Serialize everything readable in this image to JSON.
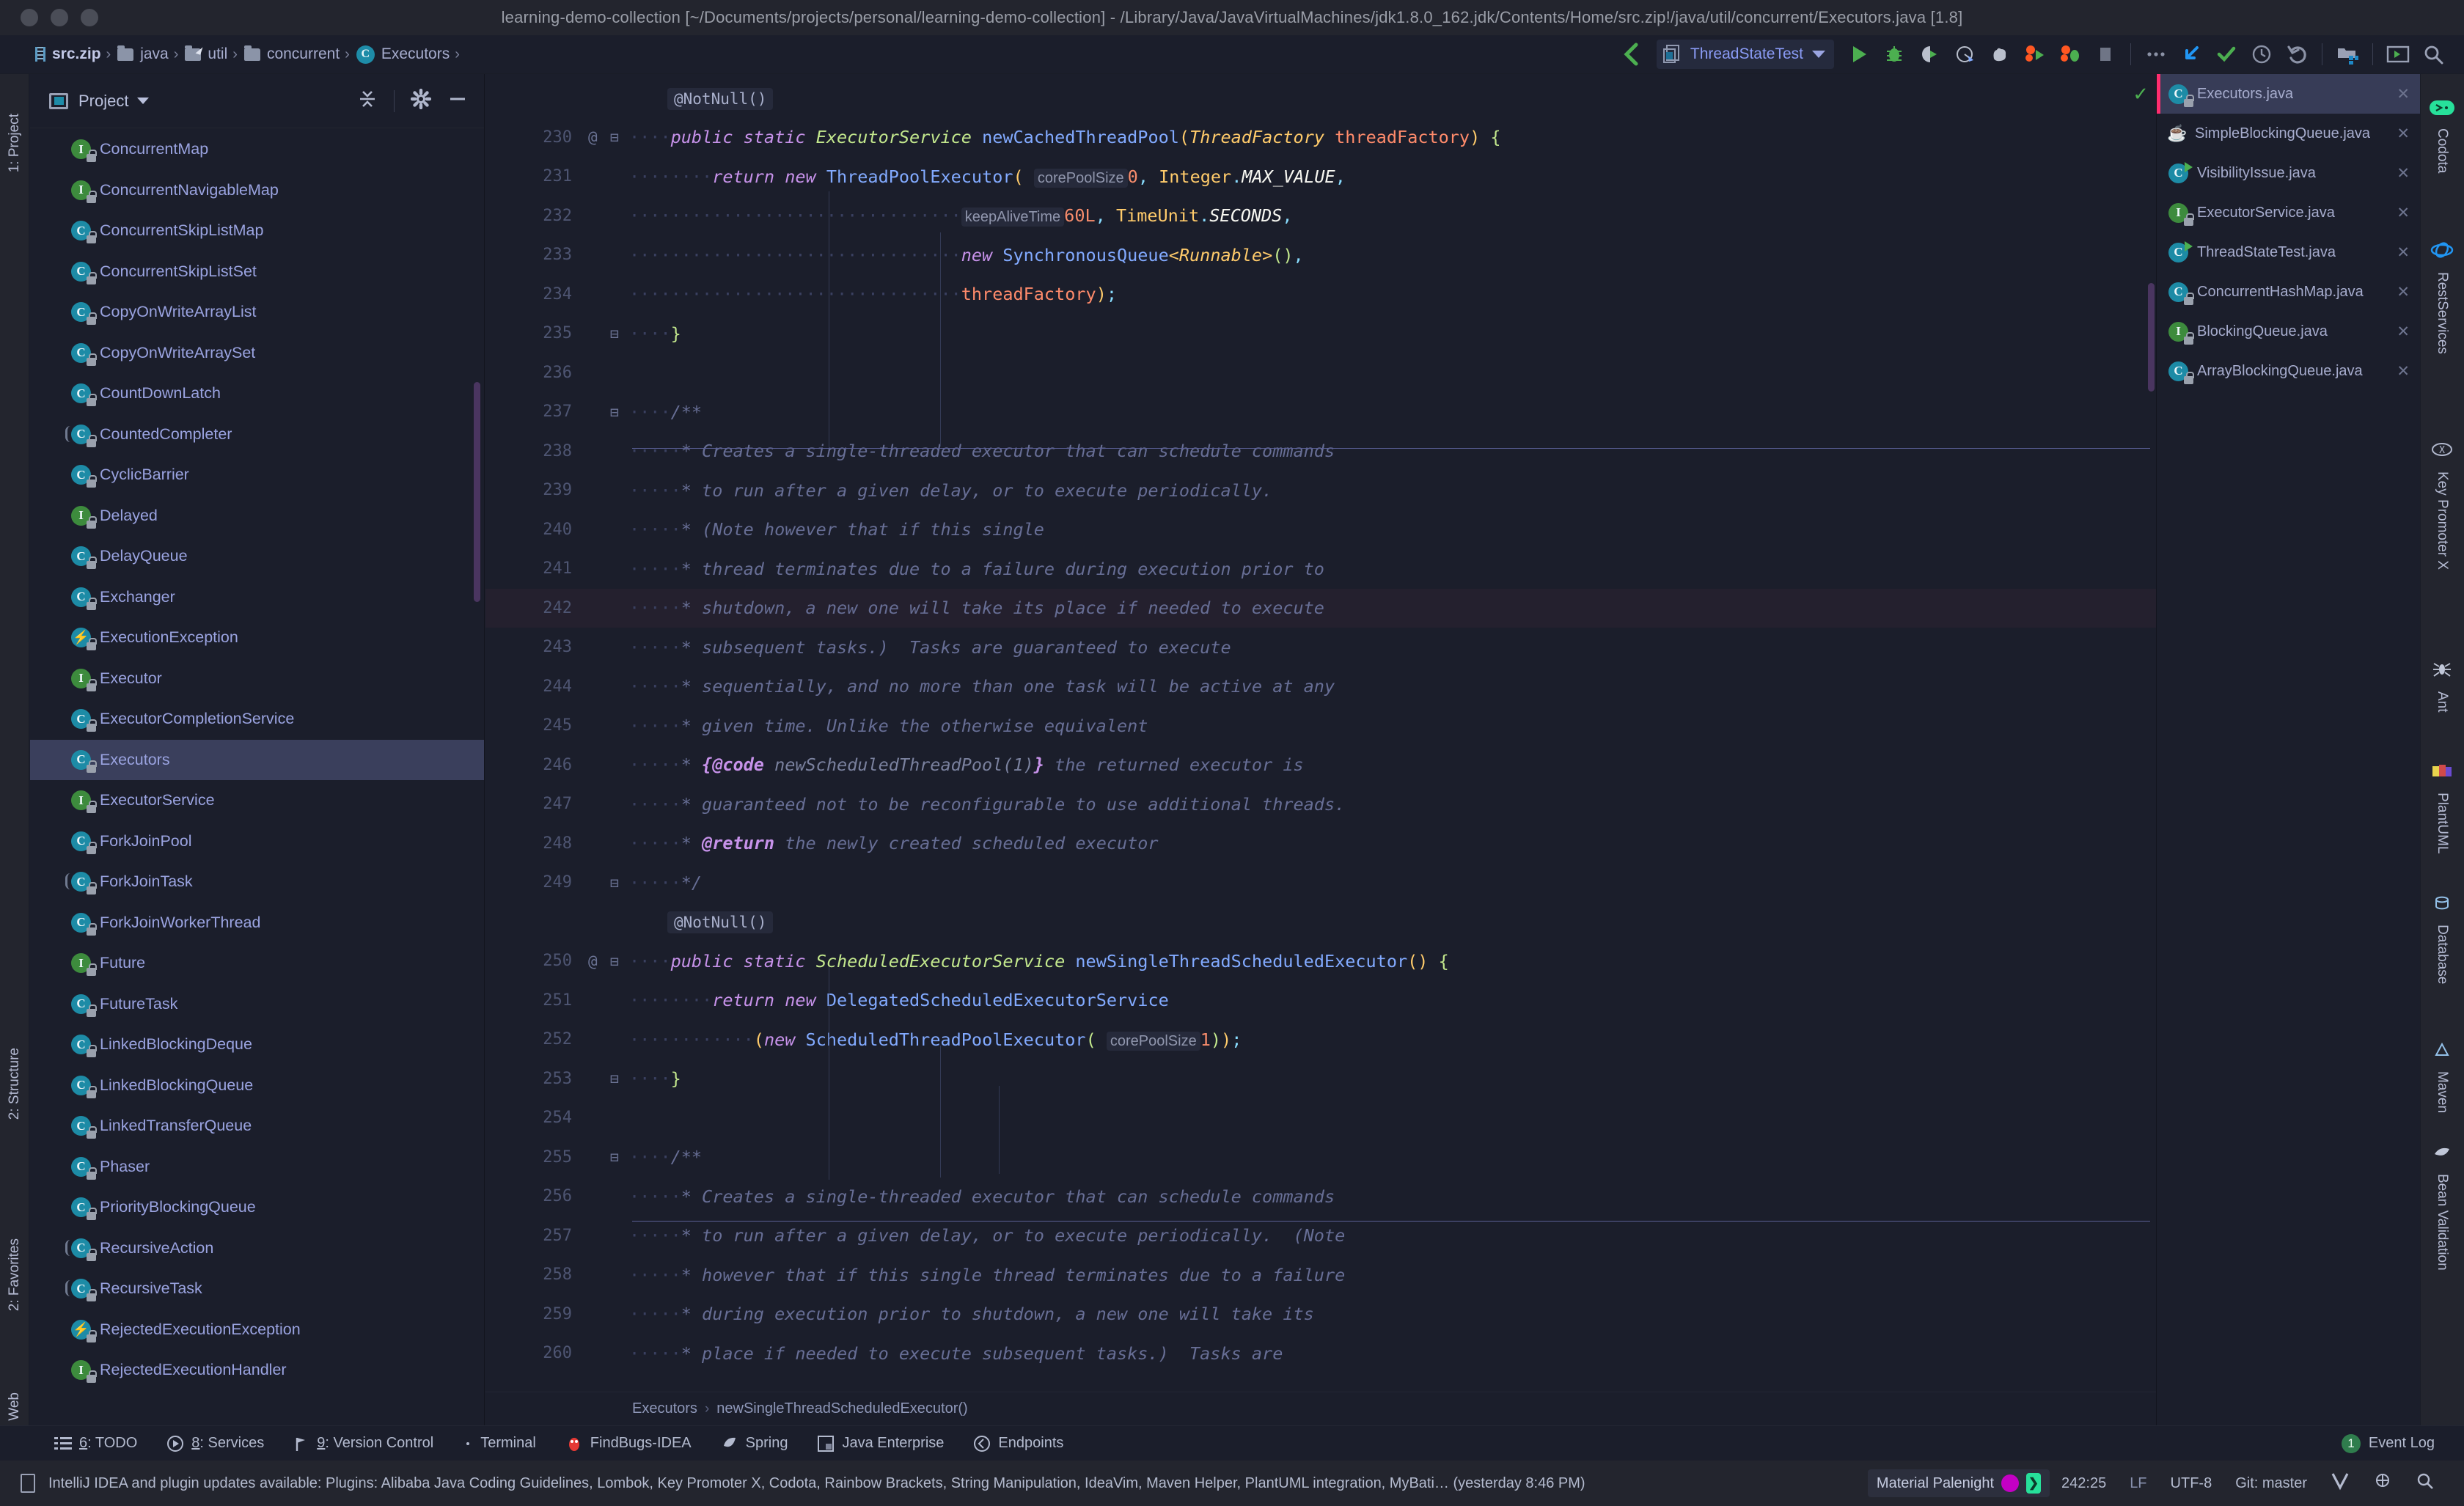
{
  "window": {
    "title": "learning-demo-collection [~/Documents/projects/personal/learning-demo-collection] - /Library/Java/JavaVirtualMachines/jdk1.8.0_162.jdk/Contents/Home/src.zip!/java/util/concurrent/Executors.java [1.8]"
  },
  "navbar": {
    "breadcrumbs": [
      {
        "label": "src.zip",
        "icon": "zip-icon"
      },
      {
        "label": "java",
        "icon": "folder-icon"
      },
      {
        "label": "util",
        "icon": "source-folder-icon"
      },
      {
        "label": "concurrent",
        "icon": "folder-icon"
      },
      {
        "label": "Executors",
        "icon": "class-icon"
      }
    ],
    "run_config": "ThreadStateTest",
    "actions": [
      "back-icon",
      "run-config-selector",
      "run-icon",
      "debug-icon",
      "run-with-coverage-icon",
      "profile-icon",
      "stop-gradle-icon",
      "run-dashboard-icon",
      "debug-dashboard-icon",
      "stop-icon",
      "more-icon",
      "get-updates-icon",
      "check-icon",
      "history-icon",
      "undo-icon",
      "project-structure-icon",
      "terminal-icon",
      "search-icon"
    ]
  },
  "left_strip": {
    "top": "1: Project",
    "items": [
      "2: Structure",
      "2: Favorites",
      "Web"
    ]
  },
  "project_panel": {
    "title": "Project",
    "actions": [
      "collapse-all-icon",
      "settings-icon",
      "hide-icon"
    ],
    "items": [
      {
        "name": "ConcurrentMap",
        "kind": "interface",
        "locked": true
      },
      {
        "name": "ConcurrentNavigableMap",
        "kind": "interface",
        "locked": true
      },
      {
        "name": "ConcurrentSkipListMap",
        "kind": "class",
        "locked": true
      },
      {
        "name": "ConcurrentSkipListSet",
        "kind": "class",
        "locked": true
      },
      {
        "name": "CopyOnWriteArrayList",
        "kind": "class",
        "locked": true
      },
      {
        "name": "CopyOnWriteArraySet",
        "kind": "class",
        "locked": true
      },
      {
        "name": "CountDownLatch",
        "kind": "class",
        "locked": true
      },
      {
        "name": "CountedCompleter",
        "kind": "abstract-class",
        "locked": true
      },
      {
        "name": "CyclicBarrier",
        "kind": "class",
        "locked": true
      },
      {
        "name": "Delayed",
        "kind": "interface",
        "locked": true
      },
      {
        "name": "DelayQueue",
        "kind": "class",
        "locked": true
      },
      {
        "name": "Exchanger",
        "kind": "class",
        "locked": true
      },
      {
        "name": "ExecutionException",
        "kind": "exception",
        "locked": true
      },
      {
        "name": "Executor",
        "kind": "interface",
        "locked": true
      },
      {
        "name": "ExecutorCompletionService",
        "kind": "class",
        "locked": true
      },
      {
        "name": "Executors",
        "kind": "class",
        "locked": true,
        "selected": true
      },
      {
        "name": "ExecutorService",
        "kind": "interface",
        "locked": true
      },
      {
        "name": "ForkJoinPool",
        "kind": "class",
        "locked": true
      },
      {
        "name": "ForkJoinTask",
        "kind": "abstract-class",
        "locked": true
      },
      {
        "name": "ForkJoinWorkerThread",
        "kind": "class",
        "locked": true
      },
      {
        "name": "Future",
        "kind": "interface",
        "locked": true
      },
      {
        "name": "FutureTask",
        "kind": "class",
        "locked": true
      },
      {
        "name": "LinkedBlockingDeque",
        "kind": "class",
        "locked": true
      },
      {
        "name": "LinkedBlockingQueue",
        "kind": "class",
        "locked": true
      },
      {
        "name": "LinkedTransferQueue",
        "kind": "class",
        "locked": true
      },
      {
        "name": "Phaser",
        "kind": "class",
        "locked": true
      },
      {
        "name": "PriorityBlockingQueue",
        "kind": "class",
        "locked": true
      },
      {
        "name": "RecursiveAction",
        "kind": "abstract-class",
        "locked": true
      },
      {
        "name": "RecursiveTask",
        "kind": "abstract-class",
        "locked": true
      },
      {
        "name": "RejectedExecutionException",
        "kind": "exception",
        "locked": true
      },
      {
        "name": "RejectedExecutionHandler",
        "kind": "interface",
        "locked": true
      }
    ]
  },
  "editor": {
    "caret_line": 242,
    "file_breadcrumb": [
      "Executors",
      "newSingleThreadScheduledExecutor()"
    ],
    "lines": [
      {
        "num": "",
        "kind": "anno-hint",
        "text": "@NotNull()"
      },
      {
        "num": "230",
        "gutter": "@",
        "fold": "minus"
      },
      {
        "num": "231"
      },
      {
        "num": "232"
      },
      {
        "num": "233"
      },
      {
        "num": "234"
      },
      {
        "num": "235",
        "fold": "end"
      },
      {
        "num": "236"
      },
      {
        "num": "237",
        "fold": "start"
      },
      {
        "num": "238"
      },
      {
        "num": "239"
      },
      {
        "num": "240"
      },
      {
        "num": "241"
      },
      {
        "num": "242",
        "caret": true
      },
      {
        "num": "243"
      },
      {
        "num": "244"
      },
      {
        "num": "245"
      },
      {
        "num": "246"
      },
      {
        "num": "247"
      },
      {
        "num": "248"
      },
      {
        "num": "249",
        "fold": "end"
      },
      {
        "num": "",
        "kind": "anno-hint",
        "text": "@NotNull()"
      },
      {
        "num": "250",
        "gutter": "@",
        "fold": "minus"
      },
      {
        "num": "251"
      },
      {
        "num": "252"
      },
      {
        "num": "253",
        "fold": "end"
      },
      {
        "num": "254"
      },
      {
        "num": "255",
        "fold": "start"
      },
      {
        "num": "256"
      },
      {
        "num": "257"
      },
      {
        "num": "258"
      },
      {
        "num": "259"
      },
      {
        "num": "260"
      }
    ],
    "code_text": {
      "l230": "public static ExecutorService newCachedThreadPool(ThreadFactory threadFactory) {",
      "l231": "return new ThreadPoolExecutor( corePoolSize: 0, Integer.MAX_VALUE,",
      "l232": "keepAliveTime: 60L, TimeUnit.SECONDS,",
      "l233": "new SynchronousQueue<Runnable>(),",
      "l234": "threadFactory);",
      "l235": "}",
      "l237": "/**",
      "l238": "* Creates a single-threaded executor that can schedule commands",
      "l239": "* to run after a given delay, or to execute periodically.",
      "l240": "* (Note however that if this single",
      "l241": "* thread terminates due to a failure during execution prior to",
      "l242": "* shutdown, a new one will take its place if needed to execute",
      "l243": "* subsequent tasks.)  Tasks are guaranteed to execute",
      "l244": "* sequentially, and no more than one task will be active at any",
      "l245": "* given time. Unlike the otherwise equivalent",
      "l246": "* {@code newScheduledThreadPool(1)} the returned executor is",
      "l247": "* guaranteed not to be reconfigurable to use additional threads.",
      "l248": "* @return the newly created scheduled executor",
      "l249": "*/",
      "l250": "public static ScheduledExecutorService newSingleThreadScheduledExecutor() {",
      "l251": "return new DelegatedScheduledExecutorService",
      "l252": "(new ScheduledThreadPoolExecutor( corePoolSize: 1));",
      "l253": "}",
      "l255": "/**",
      "l256": "* Creates a single-threaded executor that can schedule commands",
      "l257": "* to run after a given delay, or to execute periodically.  (Note",
      "l258": "* however that if this single thread terminates due to a failure",
      "l259": "* during execution prior to shutdown, a new one will take its",
      "l260": "* place if needed to execute subsequent tasks.)  Tasks are"
    }
  },
  "file_tabs": [
    {
      "name": "Executors.java",
      "kind": "class",
      "locked": true,
      "active": true
    },
    {
      "name": "SimpleBlockingQueue.java",
      "kind": "java-file"
    },
    {
      "name": "VisibilityIssue.java",
      "kind": "runnable-class"
    },
    {
      "name": "ExecutorService.java",
      "kind": "interface",
      "locked": true
    },
    {
      "name": "ThreadStateTest.java",
      "kind": "runnable-class"
    },
    {
      "name": "ConcurrentHashMap.java",
      "kind": "class",
      "locked": true
    },
    {
      "name": "BlockingQueue.java",
      "kind": "interface",
      "locked": true
    },
    {
      "name": "ArrayBlockingQueue.java",
      "kind": "class",
      "locked": true
    }
  ],
  "right_strip": [
    {
      "label": "Codota",
      "icon": "codota-icon"
    },
    {
      "label": "RestServices",
      "icon": "rest-services-icon"
    },
    {
      "label": "Key Promoter X",
      "icon": "key-promoter-icon"
    },
    {
      "label": "Ant",
      "icon": "ant-icon"
    },
    {
      "label": "PlantUML",
      "icon": "plantuml-icon"
    },
    {
      "label": "Database",
      "icon": "database-icon"
    },
    {
      "label": "Maven",
      "icon": "maven-icon"
    },
    {
      "label": "Bean Validation",
      "icon": "bean-validation-icon"
    }
  ],
  "tool_windows": [
    {
      "num": "6",
      "label": ": TODO",
      "icon": "todo-icon"
    },
    {
      "num": "8",
      "label": ": Services",
      "icon": "services-icon"
    },
    {
      "num": "9",
      "label": ": Version Control",
      "icon": "vcs-icon"
    },
    {
      "num": "",
      "label": "Terminal",
      "icon": "terminal-icon"
    },
    {
      "num": "",
      "label": "FindBugs-IDEA",
      "icon": "findbugs-icon"
    },
    {
      "num": "",
      "label": "Spring",
      "icon": "spring-icon"
    },
    {
      "num": "",
      "label": "Java Enterprise",
      "icon": "java-enterprise-icon"
    },
    {
      "num": "",
      "label": "Endpoints",
      "icon": "endpoints-icon"
    }
  ],
  "event_log": {
    "count": "1",
    "label": "Event Log"
  },
  "status_bar": {
    "message": "IntelliJ IDEA and plugin updates available: Plugins: Alibaba Java Coding Guidelines, Lombok, Key Promoter X, Codota, Rainbow Brackets, String Manipulation, IdeaVim, Maven Helper, PlantUML integration, MyBati… (yesterday 8:46 PM)",
    "theme": "Material Palenight",
    "caret_position": "242:25",
    "line_separator": "LF",
    "encoding": "UTF-8",
    "branch": "Git: master"
  }
}
